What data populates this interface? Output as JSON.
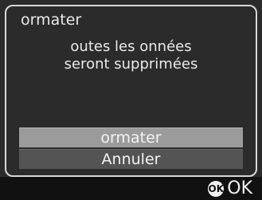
{
  "dialog": {
    "title": "ormater",
    "message_lines": [
      "outes les   onnées",
      "seront supprimées"
    ]
  },
  "menu": {
    "items": [
      {
        "label": "ormater",
        "selected": true
      },
      {
        "label": "Annuler",
        "selected": false
      }
    ]
  },
  "footer": {
    "ok_icon_label": "OK",
    "ok_label": "OK"
  },
  "colors": {
    "screen_bg": "#2b2b2b",
    "frame_border": "#d8d8d8",
    "selected_item_bg": "#9b9b9b",
    "unselected_item_bg": "#545454",
    "footer_bg": "#111111"
  }
}
